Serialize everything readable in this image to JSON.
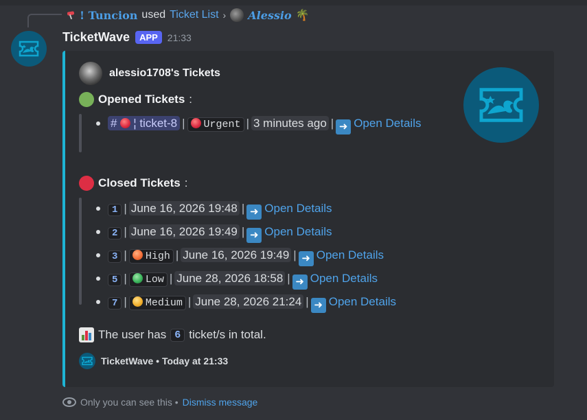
{
  "reply": {
    "command_user": "! Tuncion",
    "used_text": "used",
    "command_name": "Ticket List",
    "target_user": "Alessio"
  },
  "message": {
    "bot_name": "TicketWave",
    "app_tag": "APP",
    "time": "21:33"
  },
  "embed": {
    "author": "alessio1708's Tickets",
    "accent_color": "#1eb4d4",
    "opened": {
      "title": "Opened Tickets",
      "items": [
        {
          "channel": "# 🔴 ¦ ticket-8",
          "priority": "Urgent",
          "age": "3 minutes ago",
          "link": "Open Details"
        }
      ]
    },
    "closed": {
      "title": "Closed Tickets",
      "items": [
        {
          "number": "1",
          "priority": "",
          "date": "June 16, 2026 19:48",
          "link": "Open Details"
        },
        {
          "number": "2",
          "priority": "",
          "date": "June 16, 2026 19:49",
          "link": "Open Details"
        },
        {
          "number": "3",
          "priority": "High",
          "priority_color": "orange",
          "date": "June 16, 2026 19:49",
          "link": "Open Details"
        },
        {
          "number": "5",
          "priority": "Low",
          "priority_color": "green",
          "date": "June 28, 2026 18:58",
          "link": "Open Details"
        },
        {
          "number": "7",
          "priority": "Medium",
          "priority_color": "yellow",
          "date": "June 28, 2026 21:24",
          "link": "Open Details"
        }
      ]
    },
    "summary": {
      "before": "The user has",
      "count": "6",
      "after": "ticket/s in total."
    },
    "footer": "TicketWave • Today at 21:33"
  },
  "ephemeral": {
    "text": "Only you can see this •",
    "dismiss": "Dismiss message"
  },
  "icons": {
    "pin": "pushpin-icon",
    "palm": "palm-tree-icon",
    "arrow": "right-arrow-icon",
    "chart": "bar-chart-icon",
    "eye": "eye-icon"
  }
}
